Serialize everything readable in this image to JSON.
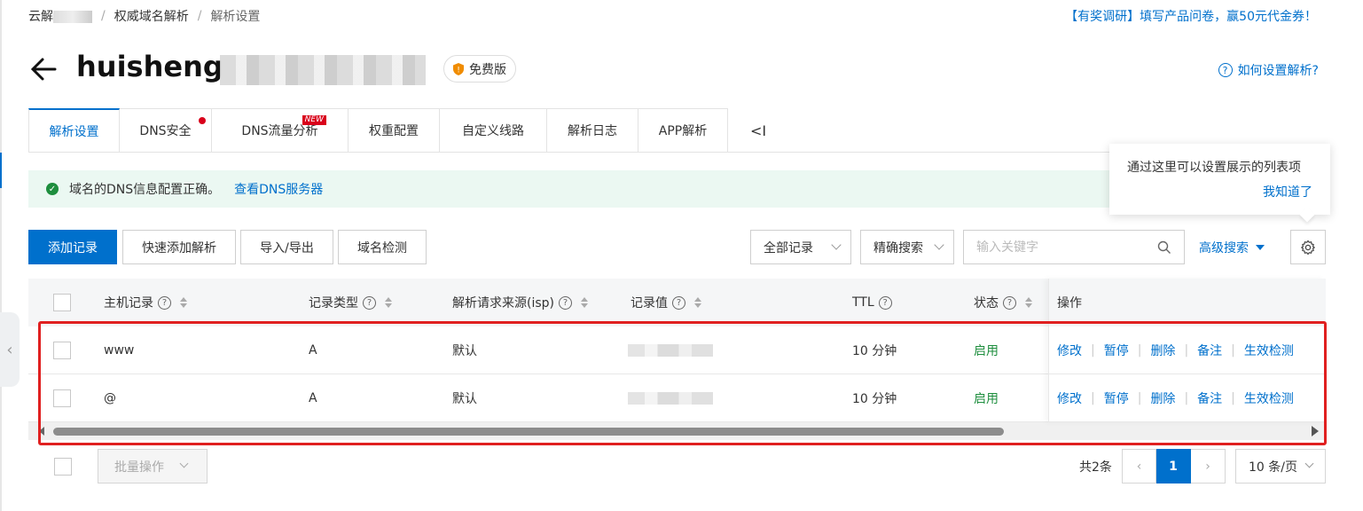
{
  "breadcrumb": {
    "root": "云解",
    "sep": "/",
    "level2": "权威域名解析",
    "level3": "解析设置"
  },
  "survey": "【有奖调研】填写产品问卷，赢50元代金券！",
  "title": {
    "domain": "huisheng",
    "badge": "免费版"
  },
  "help": "如何设置解析?",
  "tabs": [
    {
      "label": "解析设置",
      "active": true
    },
    {
      "label": "DNS安全",
      "dot": true
    },
    {
      "label": "DNS流量分析",
      "new": "NEW"
    },
    {
      "label": "权重配置"
    },
    {
      "label": "自定义线路"
    },
    {
      "label": "解析日志"
    },
    {
      "label": "APP解析"
    }
  ],
  "tabs_more": "<I",
  "notice": {
    "text": "域名的DNS信息配置正确。",
    "link": "查看DNS服务器"
  },
  "popover": {
    "text": "通过这里可以设置展示的列表项",
    "confirm": "我知道了"
  },
  "toolbar": {
    "add": "添加记录",
    "quick_add": "快速添加解析",
    "import_export": "导入/导出",
    "check": "域名检测",
    "filter_select": "全部记录",
    "match_select": "精确搜索",
    "search_placeholder": "输入关键字",
    "advanced": "高级搜索"
  },
  "table": {
    "headers": {
      "host": "主机记录",
      "type": "记录类型",
      "isp": "解析请求来源(isp)",
      "value": "记录值",
      "ttl": "TTL",
      "status": "状态",
      "ops": "操作"
    },
    "rows": [
      {
        "host": "www",
        "type": "A",
        "isp": "默认",
        "ttl": "10 分钟",
        "status": "启用"
      },
      {
        "host": "@",
        "type": "A",
        "isp": "默认",
        "ttl": "10 分钟",
        "status": "启用"
      }
    ],
    "ops": {
      "edit": "修改",
      "pause": "暂停",
      "delete": "删除",
      "remark": "备注",
      "verify": "生效检测",
      "sep": "|"
    }
  },
  "footer": {
    "batch": "批量操作",
    "total": "共2条",
    "current_page": "1",
    "page_size": "10 条/页"
  },
  "colors": {
    "primary": "#0070cc",
    "success": "#1e8e3e",
    "highlight": "#e02020",
    "badge_red": "#d9001b"
  }
}
